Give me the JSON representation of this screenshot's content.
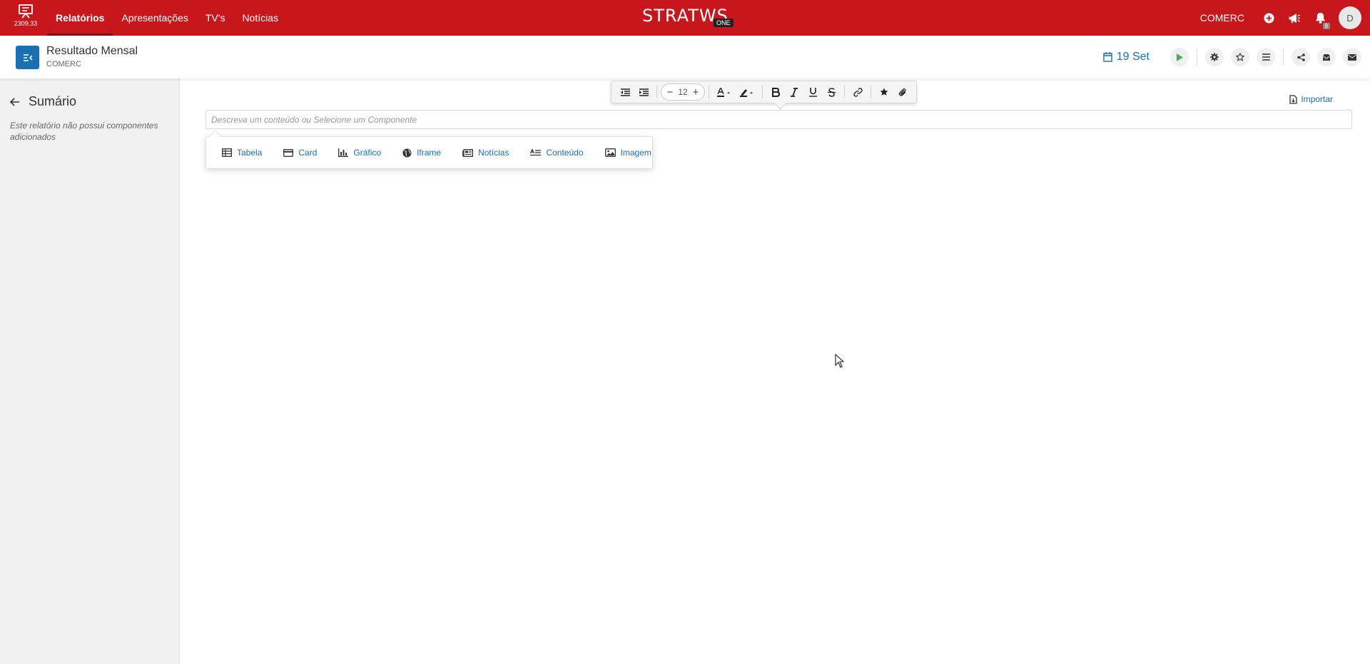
{
  "app": {
    "version": "2309.33",
    "logo_text": "STRATWS",
    "logo_badge": "ONE",
    "brand_color": "#c8161d"
  },
  "nav": {
    "items": [
      {
        "label": "Relatórios",
        "active": true
      },
      {
        "label": "Apresentações",
        "active": false
      },
      {
        "label": "TV's",
        "active": false
      },
      {
        "label": "Notícias",
        "active": false
      }
    ]
  },
  "topbar": {
    "company": "COMERC",
    "notification_count": "9",
    "avatar_initial": "D",
    "icons": [
      "add-circle-icon",
      "megaphone-icon",
      "bell-icon"
    ]
  },
  "report": {
    "title": "Resultado Mensal",
    "subtitle": "COMERC",
    "date": "19 Set"
  },
  "sidebar": {
    "title": "Sumário",
    "empty_message": "Este relatório não possui componentes adicionados"
  },
  "toolbar": {
    "font_size": "12"
  },
  "editor": {
    "import_label": "Importar",
    "placeholder": "Descreva um conteúdo ou Selecione um Componente",
    "components": [
      {
        "label": "Tabela",
        "icon": "table-icon"
      },
      {
        "label": "Card",
        "icon": "card-icon"
      },
      {
        "label": "Gráfico",
        "icon": "chart-icon"
      },
      {
        "label": "Iframe",
        "icon": "globe-icon"
      },
      {
        "label": "Notícias",
        "icon": "newspaper-icon"
      },
      {
        "label": "Conteúdo",
        "icon": "text-content-icon"
      },
      {
        "label": "Imagem",
        "icon": "image-icon"
      }
    ]
  }
}
